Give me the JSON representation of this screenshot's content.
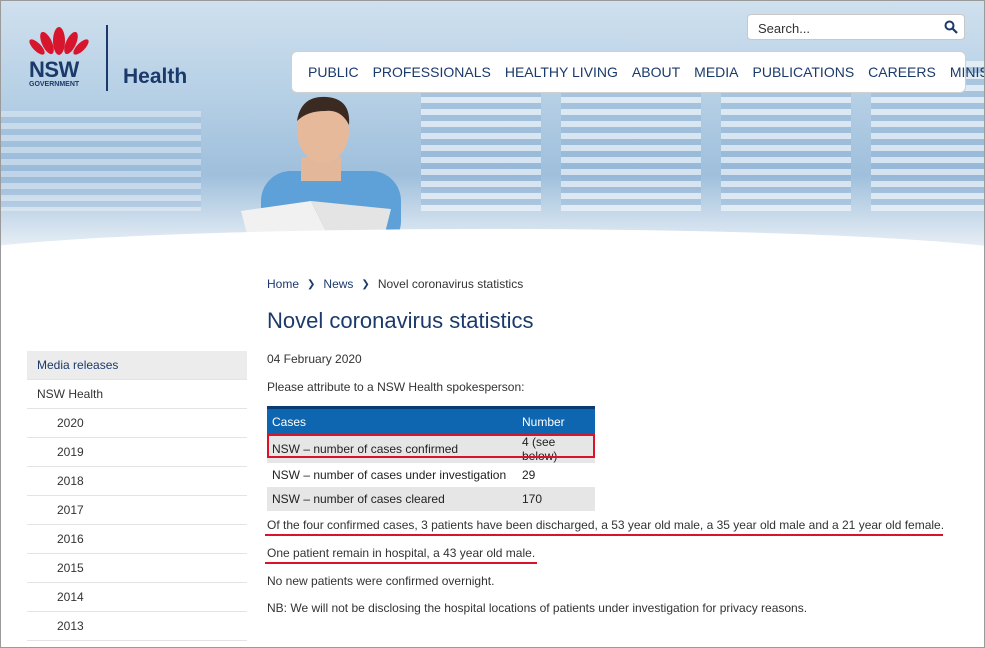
{
  "brand": {
    "logo_nsw": "NSW",
    "logo_gov": "GOVERNMENT",
    "logo_health": "Health"
  },
  "search": {
    "placeholder": "Search..."
  },
  "nav": [
    "PUBLIC",
    "PROFESSIONALS",
    "HEALTHY LIVING",
    "ABOUT",
    "MEDIA",
    "PUBLICATIONS",
    "CAREERS",
    "MINISTERS"
  ],
  "breadcrumb": {
    "home": "Home",
    "news": "News",
    "current": "Novel coronavirus statistics"
  },
  "page": {
    "title": "Novel coronavirus statistics",
    "date": "04 February 2020",
    "attribution": "Please attribute to a NSW Health spokesperson:"
  },
  "sidebar": {
    "top": "Media releases",
    "section": "NSW Health",
    "years": [
      "2020",
      "2019",
      "2018",
      "2017",
      "2016",
      "2015",
      "2014",
      "2013"
    ]
  },
  "table": {
    "headers": [
      "Cases",
      "Number"
    ],
    "rows": [
      [
        "NSW – number of cases confirmed",
        "4 (see below)"
      ],
      [
        "NSW – number of cases under investigation",
        "29"
      ],
      [
        "NSW – number of cases cleared",
        "170"
      ]
    ]
  },
  "body": {
    "p1": "Of the four confirmed cases, 3 patients have been discharged, a 53 year old male, a 35 year old male and a 21 year old female.",
    "p2": "One patient remain in hospital, a 43 year old male.",
    "p3": "No new patients were confirmed overnight.",
    "p4": "NB: We will not be disclosing the hospital locations of patients under investigation for privacy reasons."
  },
  "colors": {
    "brand_navy": "#1b3a6b",
    "table_header": "#0e66b0",
    "highlight_red": "#d8132b"
  }
}
